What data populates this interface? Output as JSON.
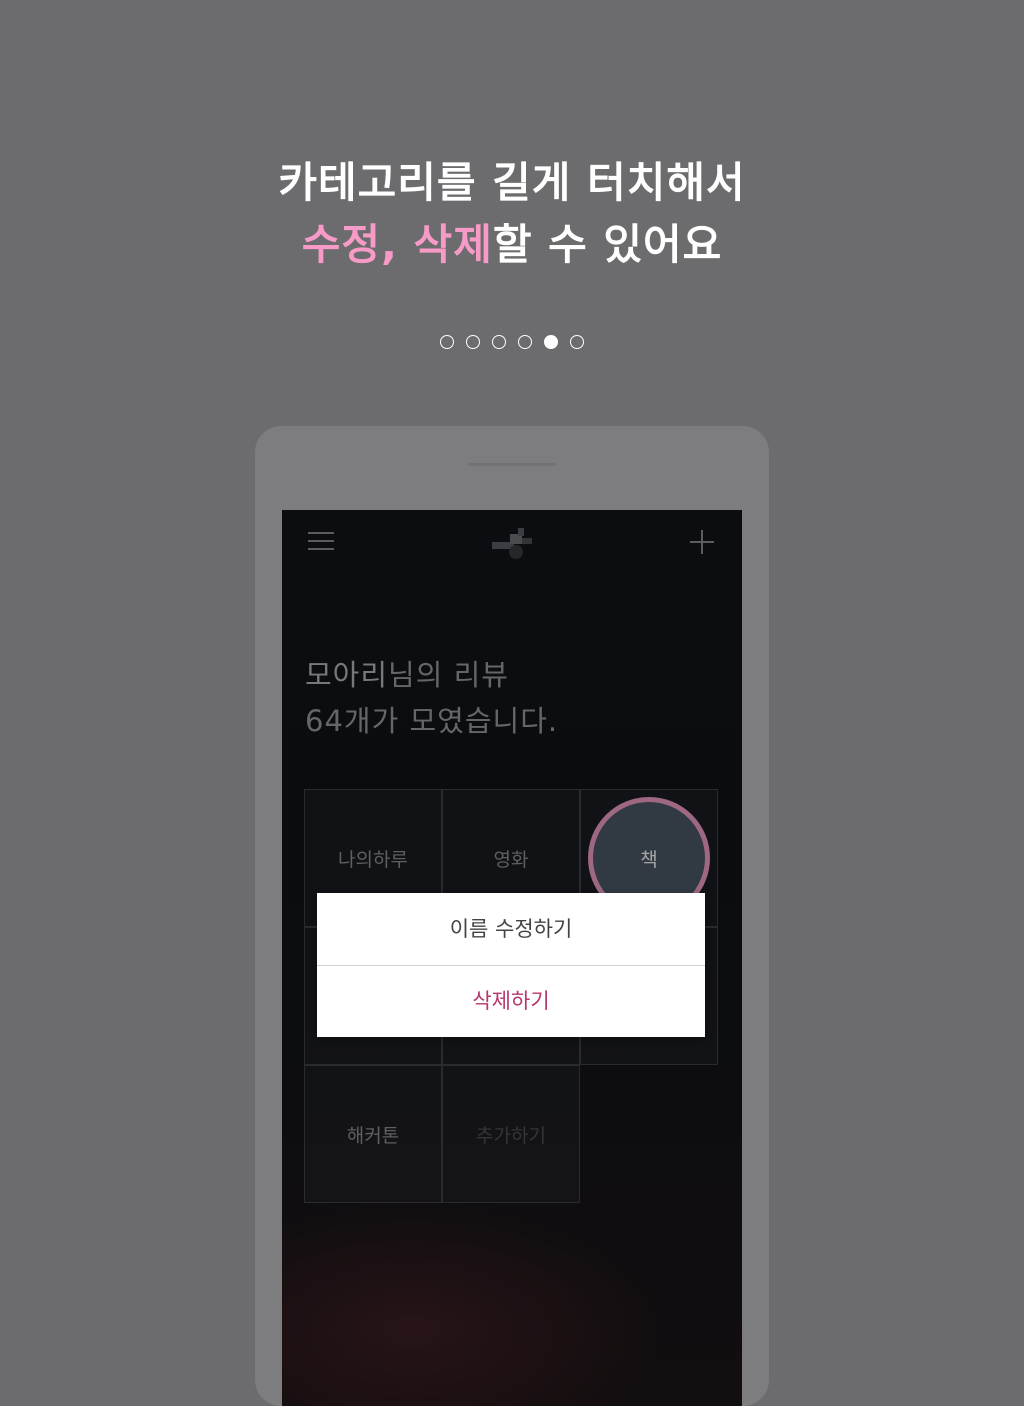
{
  "headline": {
    "line1": "카테고리를 길게 터치해서",
    "line2_accent": "수정, 삭제",
    "line2_rest": "할 수 있어요"
  },
  "pagination": {
    "total": 6,
    "active_index": 4
  },
  "colors": {
    "accent_pink": "#f79ac8",
    "delete_text": "#b8366e",
    "selection_ring": "#f4a0c8"
  },
  "app": {
    "header": {
      "menu_icon": "hamburger-menu-icon",
      "logo_icon": "app-logo-icon",
      "add_icon": "plus-icon"
    },
    "review": {
      "name": "모아리",
      "name_suffix": "님의 리뷰",
      "count_line": "64개가 모였습니다."
    },
    "categories": [
      "나의하루",
      "영화",
      "책",
      "해커톤",
      "추가하기"
    ],
    "selected_category": "책",
    "context_menu": {
      "rename": "이름 수정하기",
      "delete": "삭제하기"
    }
  }
}
